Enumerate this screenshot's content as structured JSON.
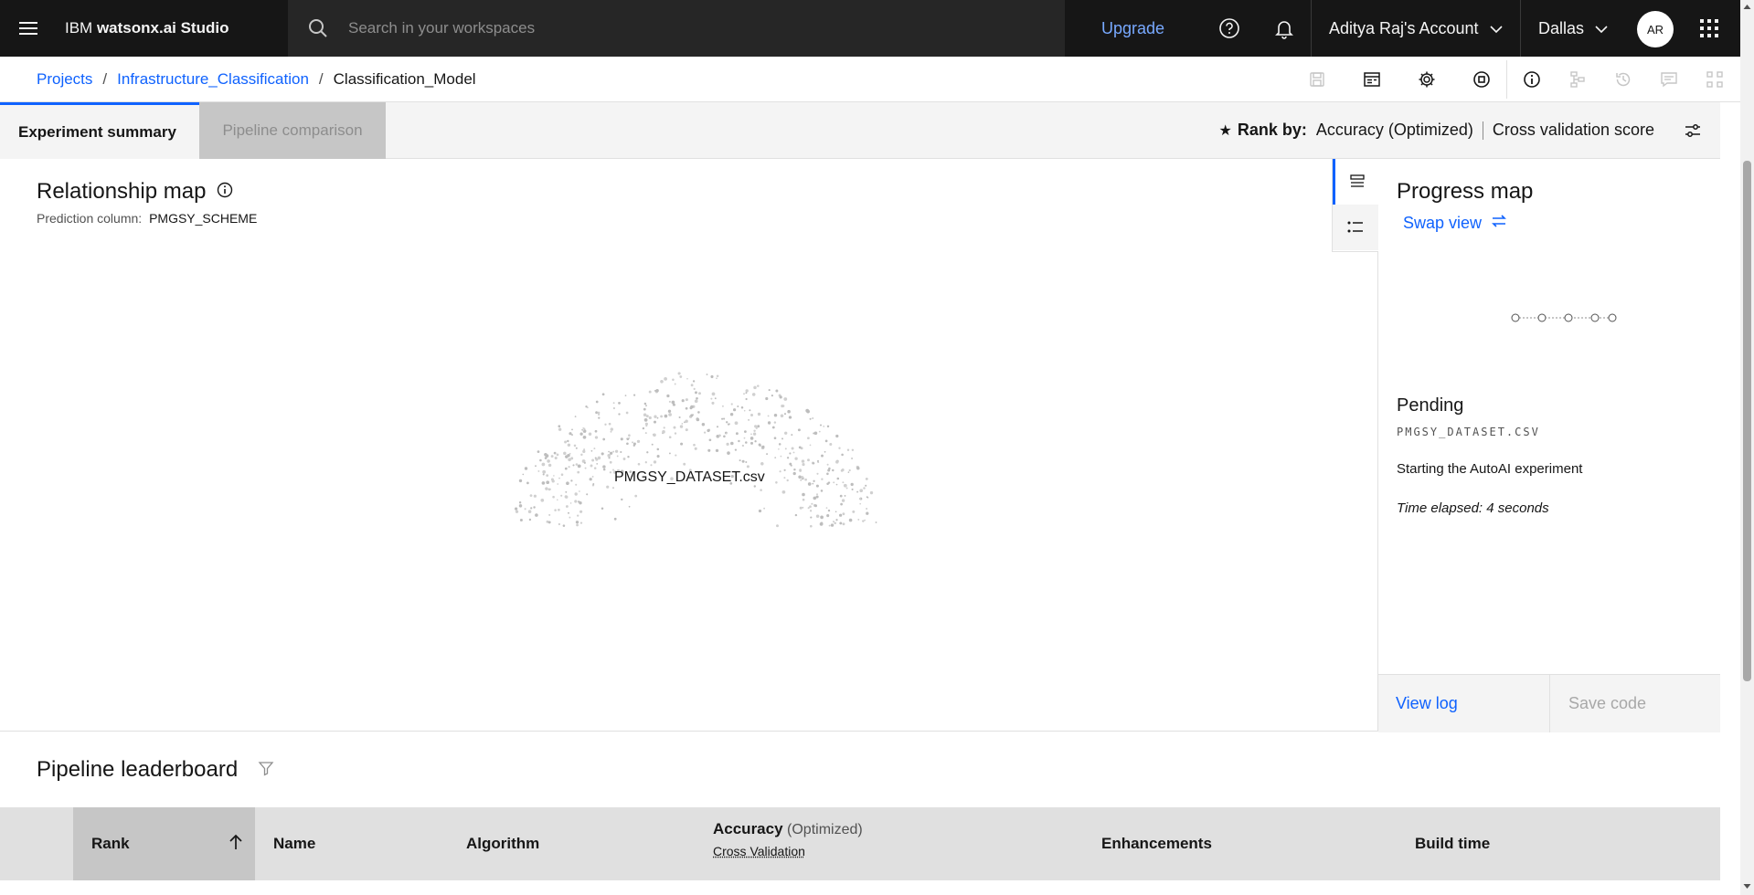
{
  "header": {
    "brand_prefix": "IBM ",
    "brand_name": "watsonx.ai Studio",
    "search_placeholder": "Search in your workspaces",
    "upgrade_label": "Upgrade",
    "account_label": "Aditya Raj's Account",
    "region_label": "Dallas",
    "avatar_initials": "AR"
  },
  "breadcrumb": {
    "items": [
      "Projects",
      "Infrastructure_Classification",
      "Classification_Model"
    ],
    "separator": "/"
  },
  "tabs": {
    "experiment_summary": "Experiment summary",
    "pipeline_comparison": "Pipeline comparison"
  },
  "rank_by": {
    "label": "Rank by:",
    "metric": "Accuracy (Optimized)",
    "score": "Cross validation score"
  },
  "relationship_map": {
    "title": "Relationship map",
    "prediction_label": "Prediction column:",
    "prediction_value": "PMGSY_SCHEME",
    "dataset_label": "PMGSY_DATASET.csv"
  },
  "progress_map": {
    "title": "Progress map",
    "swap_label": "Swap view",
    "status": "Pending",
    "file": "PMGSY_DATASET.CSV",
    "message": "Starting the AutoAI experiment",
    "elapsed": "Time elapsed: 4 seconds",
    "view_log": "View log",
    "save_code": "Save code"
  },
  "leaderboard": {
    "title": "Pipeline leaderboard",
    "columns": {
      "rank": "Rank",
      "name": "Name",
      "algorithm": "Algorithm",
      "accuracy": "Accuracy",
      "accuracy_note": "(Optimized)",
      "cross_validation": "Cross Validation",
      "enhancements": "Enhancements",
      "build_time": "Build time"
    }
  },
  "colors": {
    "accent": "#0f62fe",
    "header_bg": "#161616",
    "upgrade_link": "#78a9ff"
  },
  "icons": [
    "menu-icon",
    "search-icon",
    "help-icon",
    "notification-icon",
    "chevron-down-icon",
    "app-switcher-icon",
    "save-icon",
    "table-icon",
    "settings-icon",
    "stop-icon",
    "info-icon",
    "tree-icon",
    "history-icon",
    "comment-icon",
    "flow-icon",
    "star-icon",
    "adjust-icon",
    "list-view-icon",
    "bullet-list-icon",
    "swap-icon",
    "filter-icon",
    "arrow-up-icon"
  ]
}
